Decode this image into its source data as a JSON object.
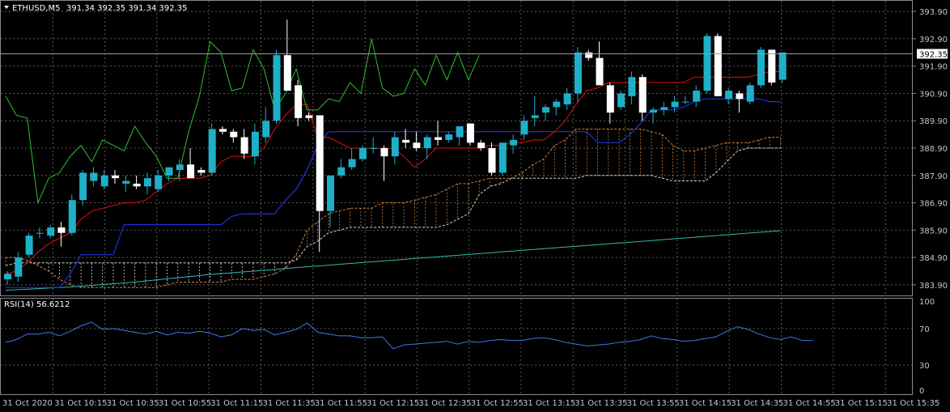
{
  "chart_data": {
    "type": "candlestick",
    "symbol_header": "ETHUSD,M5",
    "ohlc_header": "391.34 392.35 391.34 392.35",
    "current_price_label": "392.35",
    "price_ylim": [
      383.6,
      394.2
    ],
    "price_ticks": [
      "393.90",
      "392.90",
      "391.90",
      "390.90",
      "389.90",
      "388.90",
      "387.90",
      "386.90",
      "385.90",
      "384.90",
      "383.90"
    ],
    "time_labels": [
      "31 Oct 2020",
      "31 Oct 10:15",
      "31 Oct 10:35",
      "31 Oct 10:55",
      "31 Oct 11:15",
      "31 Oct 11:35",
      "31 Oct 11:55",
      "31 Oct 12:15",
      "31 Oct 12:35",
      "31 Oct 12:55",
      "31 Oct 13:15",
      "31 Oct 13:35",
      "31 Oct 13:55",
      "31 Oct 14:15",
      "31 Oct 14:35",
      "31 Oct 14:55",
      "31 Oct 15:15",
      "31 Oct 15:35"
    ],
    "candles": [
      {
        "o": 384.1,
        "h": 384.4,
        "l": 383.9,
        "c": 384.3
      },
      {
        "o": 384.2,
        "h": 385.1,
        "l": 384.0,
        "c": 384.9
      },
      {
        "o": 385.0,
        "h": 385.8,
        "l": 384.9,
        "c": 385.7
      },
      {
        "o": 385.8,
        "h": 386.0,
        "l": 385.6,
        "c": 385.8
      },
      {
        "o": 385.7,
        "h": 386.1,
        "l": 385.6,
        "c": 386.0
      },
      {
        "o": 386.0,
        "h": 386.2,
        "l": 385.3,
        "c": 385.8
      },
      {
        "o": 385.8,
        "h": 387.2,
        "l": 385.7,
        "c": 387.0
      },
      {
        "o": 387.0,
        "h": 388.1,
        "l": 386.8,
        "c": 388.0
      },
      {
        "o": 387.7,
        "h": 388.2,
        "l": 387.5,
        "c": 388.0
      },
      {
        "o": 387.5,
        "h": 388.1,
        "l": 387.4,
        "c": 387.9
      },
      {
        "o": 387.9,
        "h": 388.1,
        "l": 387.6,
        "c": 387.8
      },
      {
        "o": 387.6,
        "h": 387.9,
        "l": 387.3,
        "c": 387.7
      },
      {
        "o": 387.6,
        "h": 387.9,
        "l": 387.4,
        "c": 387.5
      },
      {
        "o": 387.5,
        "h": 388.0,
        "l": 387.2,
        "c": 387.8
      },
      {
        "o": 387.4,
        "h": 388.1,
        "l": 387.3,
        "c": 387.9
      },
      {
        "o": 387.9,
        "h": 388.2,
        "l": 387.7,
        "c": 388.2
      },
      {
        "o": 388.1,
        "h": 388.5,
        "l": 387.7,
        "c": 388.3
      },
      {
        "o": 388.3,
        "h": 388.9,
        "l": 387.8,
        "c": 387.8
      },
      {
        "o": 388.1,
        "h": 388.2,
        "l": 387.9,
        "c": 388.0
      },
      {
        "o": 388.0,
        "h": 389.8,
        "l": 387.9,
        "c": 389.6
      },
      {
        "o": 389.6,
        "h": 389.7,
        "l": 389.4,
        "c": 389.5
      },
      {
        "o": 389.5,
        "h": 389.6,
        "l": 389.1,
        "c": 389.3
      },
      {
        "o": 389.3,
        "h": 389.6,
        "l": 388.5,
        "c": 388.7
      },
      {
        "o": 388.6,
        "h": 389.8,
        "l": 388.3,
        "c": 389.5
      },
      {
        "o": 389.3,
        "h": 390.4,
        "l": 389.1,
        "c": 389.9
      },
      {
        "o": 389.9,
        "h": 392.5,
        "l": 389.8,
        "c": 392.3
      },
      {
        "o": 392.3,
        "h": 393.6,
        "l": 391.0,
        "c": 391.0
      },
      {
        "o": 391.2,
        "h": 391.4,
        "l": 389.7,
        "c": 390.0
      },
      {
        "o": 390.1,
        "h": 390.2,
        "l": 389.9,
        "c": 390.0
      },
      {
        "o": 390.1,
        "h": 390.1,
        "l": 385.1,
        "c": 386.6
      },
      {
        "o": 386.6,
        "h": 387.8,
        "l": 386.0,
        "c": 387.9
      },
      {
        "o": 387.9,
        "h": 388.5,
        "l": 387.8,
        "c": 388.2
      },
      {
        "o": 388.2,
        "h": 388.9,
        "l": 388.1,
        "c": 388.5
      },
      {
        "o": 388.5,
        "h": 389.0,
        "l": 388.4,
        "c": 388.9
      },
      {
        "o": 388.9,
        "h": 389.3,
        "l": 388.7,
        "c": 388.9
      },
      {
        "o": 388.9,
        "h": 389.0,
        "l": 387.7,
        "c": 388.6
      },
      {
        "o": 388.6,
        "h": 389.5,
        "l": 388.3,
        "c": 389.3
      },
      {
        "o": 389.2,
        "h": 389.6,
        "l": 388.9,
        "c": 389.1
      },
      {
        "o": 389.1,
        "h": 389.5,
        "l": 388.8,
        "c": 388.9
      },
      {
        "o": 388.9,
        "h": 389.4,
        "l": 388.5,
        "c": 389.3
      },
      {
        "o": 389.3,
        "h": 389.9,
        "l": 389.0,
        "c": 389.2
      },
      {
        "o": 389.2,
        "h": 389.5,
        "l": 389.1,
        "c": 389.4
      },
      {
        "o": 389.3,
        "h": 389.7,
        "l": 389.0,
        "c": 389.7
      },
      {
        "o": 389.8,
        "h": 389.8,
        "l": 389.0,
        "c": 389.1
      },
      {
        "o": 389.1,
        "h": 389.2,
        "l": 388.8,
        "c": 388.9
      },
      {
        "o": 388.9,
        "h": 389.1,
        "l": 387.9,
        "c": 388.0
      },
      {
        "o": 388.0,
        "h": 389.1,
        "l": 387.9,
        "c": 389.1
      },
      {
        "o": 389.0,
        "h": 389.4,
        "l": 388.7,
        "c": 389.2
      },
      {
        "o": 389.4,
        "h": 390.1,
        "l": 389.2,
        "c": 389.9
      },
      {
        "o": 390.0,
        "h": 390.8,
        "l": 389.7,
        "c": 390.1
      },
      {
        "o": 390.2,
        "h": 390.5,
        "l": 389.9,
        "c": 390.4
      },
      {
        "o": 390.4,
        "h": 390.7,
        "l": 390.1,
        "c": 390.6
      },
      {
        "o": 390.5,
        "h": 391.1,
        "l": 390.3,
        "c": 390.9
      },
      {
        "o": 390.9,
        "h": 392.6,
        "l": 390.6,
        "c": 392.4
      },
      {
        "o": 392.4,
        "h": 392.5,
        "l": 392.1,
        "c": 392.2
      },
      {
        "o": 392.2,
        "h": 392.8,
        "l": 391.3,
        "c": 391.2
      },
      {
        "o": 391.2,
        "h": 391.3,
        "l": 389.8,
        "c": 390.2
      },
      {
        "o": 390.4,
        "h": 391.0,
        "l": 390.3,
        "c": 390.9
      },
      {
        "o": 390.8,
        "h": 391.7,
        "l": 390.5,
        "c": 391.5
      },
      {
        "o": 391.5,
        "h": 391.6,
        "l": 389.9,
        "c": 390.2
      },
      {
        "o": 390.2,
        "h": 390.4,
        "l": 389.8,
        "c": 390.3
      },
      {
        "o": 390.3,
        "h": 390.6,
        "l": 390.1,
        "c": 390.4
      },
      {
        "o": 390.4,
        "h": 390.8,
        "l": 390.2,
        "c": 390.6
      },
      {
        "o": 390.6,
        "h": 390.8,
        "l": 390.5,
        "c": 390.6
      },
      {
        "o": 390.6,
        "h": 391.2,
        "l": 390.4,
        "c": 391.0
      },
      {
        "o": 391.0,
        "h": 393.1,
        "l": 390.9,
        "c": 393.0
      },
      {
        "o": 393.0,
        "h": 393.1,
        "l": 390.8,
        "c": 390.8
      },
      {
        "o": 390.7,
        "h": 391.1,
        "l": 390.5,
        "c": 391.0
      },
      {
        "o": 390.9,
        "h": 391.0,
        "l": 390.2,
        "c": 390.7
      },
      {
        "o": 390.6,
        "h": 391.3,
        "l": 390.5,
        "c": 391.2
      },
      {
        "o": 391.2,
        "h": 392.6,
        "l": 391.1,
        "c": 392.5
      },
      {
        "o": 392.5,
        "h": 392.5,
        "l": 391.2,
        "c": 391.3
      },
      {
        "o": 391.4,
        "h": 392.4,
        "l": 391.3,
        "c": 392.4
      }
    ],
    "tenkan_sen": [
      384.3,
      384.4,
      384.7,
      385.1,
      385.4,
      385.6,
      385.8,
      386.3,
      386.6,
      386.7,
      386.8,
      386.9,
      386.9,
      387.0,
      387.3,
      387.6,
      387.8,
      387.8,
      387.8,
      387.9,
      388.4,
      388.6,
      388.6,
      388.6,
      388.9,
      389.6,
      390.1,
      390.5,
      390.5,
      389.3,
      389.3,
      389.1,
      388.9,
      388.9,
      388.9,
      388.9,
      388.9,
      388.6,
      388.2,
      388.5,
      388.9,
      388.9,
      388.9,
      388.9,
      388.9,
      389.0,
      389.0,
      389.1,
      389.1,
      389.2,
      389.2,
      389.5,
      389.9,
      390.5,
      391.0,
      391.1,
      391.3,
      391.3,
      391.3,
      391.3,
      391.3,
      391.3,
      391.3,
      391.3,
      391.5,
      391.5,
      391.5,
      391.5,
      391.5,
      391.5,
      391.6,
      391.7,
      391.7
    ],
    "kijun_sen": [
      383.8,
      383.8,
      383.8,
      383.8,
      383.8,
      383.8,
      384.2,
      384.9,
      384.9,
      384.9,
      385.4,
      386.4,
      386.4,
      386.4,
      386.4,
      386.4,
      386.5,
      386.5,
      386.5,
      386.5,
      386.5,
      386.5,
      386.8,
      386.8,
      386.8,
      386.8,
      386.8,
      386.8,
      386.8,
      386.8,
      386.8,
      386.8,
      386.8,
      386.8,
      386.8,
      386.8,
      386.8,
      386.8,
      386.8,
      386.8,
      386.8,
      386.8,
      386.8,
      386.8,
      386.8,
      386.8,
      386.8,
      386.8,
      386.8,
      386.8,
      386.8,
      386.8,
      386.8,
      386.8,
      386.8,
      386.8,
      386.8,
      386.8,
      386.8,
      386.8,
      386.8,
      386.8,
      386.8,
      386.8,
      386.8,
      386.8,
      386.8,
      386.8,
      386.8,
      386.8,
      386.8,
      386.8,
      386.8
    ],
    "kijun_sen_actual": [
      383.8,
      383.8,
      383.8,
      383.8,
      383.8,
      383.8,
      384.3,
      385.0,
      385.0,
      385.0,
      385.0,
      386.1,
      386.1,
      386.1,
      386.1,
      386.1,
      386.1,
      386.1,
      386.1,
      386.1,
      386.1,
      386.4,
      386.5,
      386.5,
      386.5,
      386.5,
      387.0,
      387.4,
      388.1,
      389.0,
      389.5,
      389.5,
      389.5,
      389.5,
      389.5,
      389.5,
      389.5,
      389.5,
      389.5,
      389.5,
      389.5,
      389.5,
      389.5,
      389.5,
      389.5,
      389.5,
      389.5,
      389.5,
      389.5,
      389.5,
      389.5,
      389.5,
      389.5,
      389.5,
      389.5,
      389.1,
      389.1,
      389.1,
      389.4,
      389.8,
      390.3,
      390.3,
      390.3,
      390.4,
      390.6,
      390.7,
      390.7,
      390.7,
      390.7,
      390.7,
      390.7,
      390.6,
      390.6
    ],
    "chikou_span": [
      390.8,
      390.1,
      390.0,
      386.9,
      387.8,
      388.0,
      388.6,
      389.0,
      388.4,
      389.2,
      389.0,
      388.8,
      389.7,
      389.1,
      388.6,
      387.8,
      387.8,
      389.5,
      390.8,
      392.8,
      392.4,
      391.0,
      391.1,
      392.5,
      391.8,
      390.3,
      390.9,
      391.8,
      390.3,
      390.3,
      390.7,
      390.6,
      391.3,
      390.9,
      392.9,
      391.1,
      390.8,
      390.9,
      391.8,
      391.2,
      392.3,
      391.4,
      392.4,
      391.4,
      392.3
    ],
    "senkou_a_dashed": [
      384.9,
      384.9,
      384.8,
      384.6,
      384.4,
      384.1,
      383.9,
      383.8,
      383.8,
      383.8,
      383.8,
      383.8,
      383.8,
      383.8,
      383.8,
      383.9,
      384.0,
      384.0,
      384.0,
      384.0,
      384.0,
      384.1,
      384.1,
      384.1,
      384.2,
      384.3,
      384.5,
      385.0,
      385.9,
      386.2,
      386.5,
      386.6,
      386.7,
      386.7,
      386.7,
      386.9,
      386.9,
      386.9,
      387.0,
      387.1,
      387.2,
      387.4,
      387.6,
      387.6,
      387.7,
      387.8,
      387.8,
      387.8,
      388.0,
      388.3,
      388.5,
      389.0,
      389.2,
      389.6,
      389.6,
      389.6,
      389.6,
      389.6,
      389.6,
      389.6,
      389.5,
      389.4,
      389.0,
      388.8,
      388.8,
      388.9,
      389.0,
      389.1,
      389.1,
      389.1,
      389.2,
      389.3,
      389.3
    ],
    "senkou_b_dashed": [
      384.6,
      384.7,
      384.7,
      384.7,
      384.7,
      384.7,
      384.7,
      384.7,
      384.7,
      384.7,
      384.7,
      384.7,
      384.7,
      384.7,
      384.7,
      384.7,
      384.7,
      384.7,
      384.7,
      384.7,
      384.7,
      384.7,
      384.7,
      384.7,
      384.7,
      384.7,
      384.7,
      384.8,
      385.3,
      385.5,
      385.8,
      385.9,
      386.0,
      386.0,
      386.0,
      386.0,
      386.0,
      386.0,
      386.0,
      386.0,
      386.0,
      386.1,
      386.3,
      386.5,
      387.2,
      387.5,
      387.6,
      387.8,
      387.8,
      387.8,
      387.8,
      387.8,
      387.8,
      387.8,
      387.9,
      387.9,
      387.9,
      387.9,
      387.9,
      387.9,
      387.9,
      387.8,
      387.7,
      387.7,
      387.7,
      387.7,
      388.0,
      388.4,
      388.8,
      388.9,
      388.9,
      388.9,
      388.9
    ],
    "moving_average": [
      383.7,
      383.72,
      383.74,
      383.76,
      383.78,
      383.8,
      383.82,
      383.85,
      383.88,
      383.91,
      383.94,
      383.97,
      384.0,
      384.04,
      384.08,
      384.12,
      384.16,
      384.2,
      384.24,
      384.28,
      384.31,
      384.34,
      384.37,
      384.4,
      384.43,
      384.46,
      384.5,
      384.53,
      384.56,
      384.59,
      384.62,
      384.65,
      384.68,
      384.71,
      384.74,
      384.77,
      384.8,
      384.83,
      384.86,
      384.89,
      384.92,
      384.95,
      384.98,
      385.01,
      385.04,
      385.07,
      385.1,
      385.13,
      385.16,
      385.19,
      385.22,
      385.25,
      385.28,
      385.31,
      385.34,
      385.37,
      385.4,
      385.43,
      385.46,
      385.49,
      385.52,
      385.55,
      385.58,
      385.61,
      385.64,
      385.67,
      385.7,
      385.73,
      385.76,
      385.79,
      385.82,
      385.85,
      385.88
    ],
    "rsi": {
      "label": "RSI(14) 56.6212",
      "ylim": [
        0,
        100
      ],
      "ticks": [
        "100",
        "70",
        "30",
        "0"
      ],
      "values": [
        55,
        58,
        64,
        64,
        66,
        62,
        67,
        73,
        77,
        69,
        70,
        68,
        66,
        64,
        67,
        63,
        66,
        65,
        67,
        65,
        61,
        63,
        70,
        68,
        69,
        63,
        66,
        69,
        76,
        66,
        64,
        62,
        62,
        60,
        60,
        61,
        48,
        52,
        53,
        54,
        55,
        56,
        53,
        56,
        55,
        57,
        58,
        57,
        57,
        59,
        60,
        58,
        55,
        53,
        51,
        52,
        53,
        55,
        56,
        58,
        62,
        59,
        58,
        56,
        57,
        59,
        61,
        67,
        72,
        69,
        64,
        60,
        58,
        61,
        57,
        57
      ]
    }
  },
  "colors": {
    "background": "#000000",
    "grid": "#5a5a5a",
    "bull": "#1eb0c8",
    "bear": "#ffffff",
    "tenkan": "#e01010",
    "kijun": "#2030e0",
    "chikou": "#2ec02e",
    "senkou_a": "#d2843c",
    "senkou_b": "#d8d8d8",
    "ma": "#35b8b0",
    "rsi": "#3f78e8",
    "text": "#c8c8c8"
  }
}
